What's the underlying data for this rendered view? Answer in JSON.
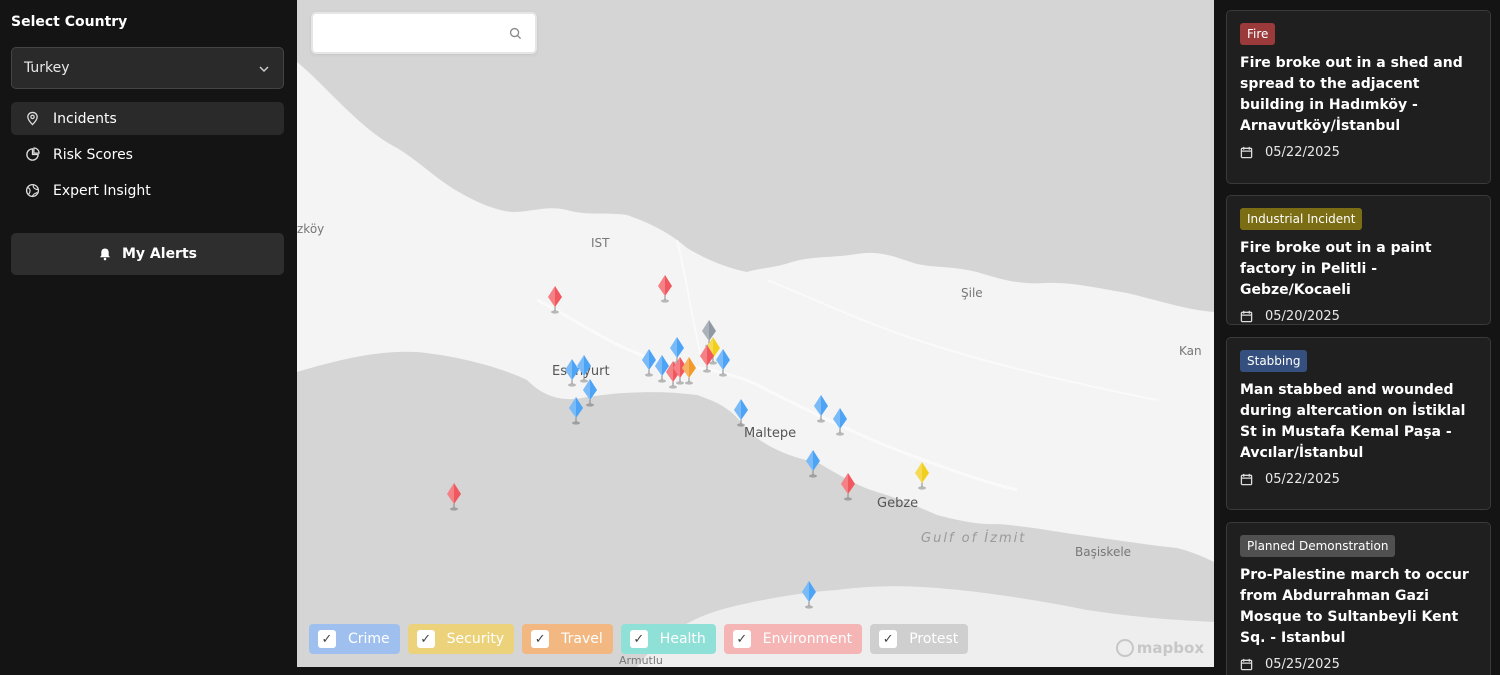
{
  "sidebar": {
    "select_label": "Select Country",
    "country": "Turkey",
    "nav": [
      {
        "label": "Incidents",
        "icon": "location-pin-icon"
      },
      {
        "label": "Risk Scores",
        "icon": "pie-chart-icon"
      },
      {
        "label": "Expert Insight",
        "icon": "globe-icon"
      }
    ],
    "alerts_label": "My Alerts"
  },
  "map": {
    "search_placeholder": "",
    "labels": [
      "IST",
      "Esenyurt",
      "Maltepe",
      "Gebze",
      "Gulf of İzmit",
      "Başiskele",
      "Şile",
      "Kan",
      "zköy",
      "Armutlu"
    ],
    "attribution": "mapbox",
    "filters": [
      {
        "label": "Crime",
        "color": "#9fc0ee"
      },
      {
        "label": "Security",
        "color": "#ecd27a"
      },
      {
        "label": "Travel",
        "color": "#f3b782"
      },
      {
        "label": "Health",
        "color": "#8fe0d6"
      },
      {
        "label": "Environment",
        "color": "#f5b5b5"
      },
      {
        "label": "Protest",
        "color": "#cfcfcf"
      }
    ]
  },
  "incidents": [
    {
      "category": "Fire",
      "category_color": "#9b3a3a",
      "title": "Fire broke out in a shed and spread to the adjacent building in Hadımköy - Arnavutköy/İstanbul",
      "date": "05/22/2025"
    },
    {
      "category": "Industrial Incident",
      "category_color": "#7a6d14",
      "title": "Fire broke out in a paint factory in Pelitli - Gebze/Kocaeli",
      "date": "05/20/2025"
    },
    {
      "category": "Stabbing",
      "category_color": "#35507e",
      "title": "Man stabbed and wounded during altercation on İstiklal St in Mustafa Kemal Paşa - Avcılar/İstanbul",
      "date": "05/22/2025"
    },
    {
      "category": "Planned Demonstration",
      "category_color": "#505050",
      "title": "Pro-Palestine march to occur from Abdurrahman Gazi Mosque to Sultanbeyli Kent Sq. - Istanbul",
      "date": "05/25/2025"
    }
  ]
}
